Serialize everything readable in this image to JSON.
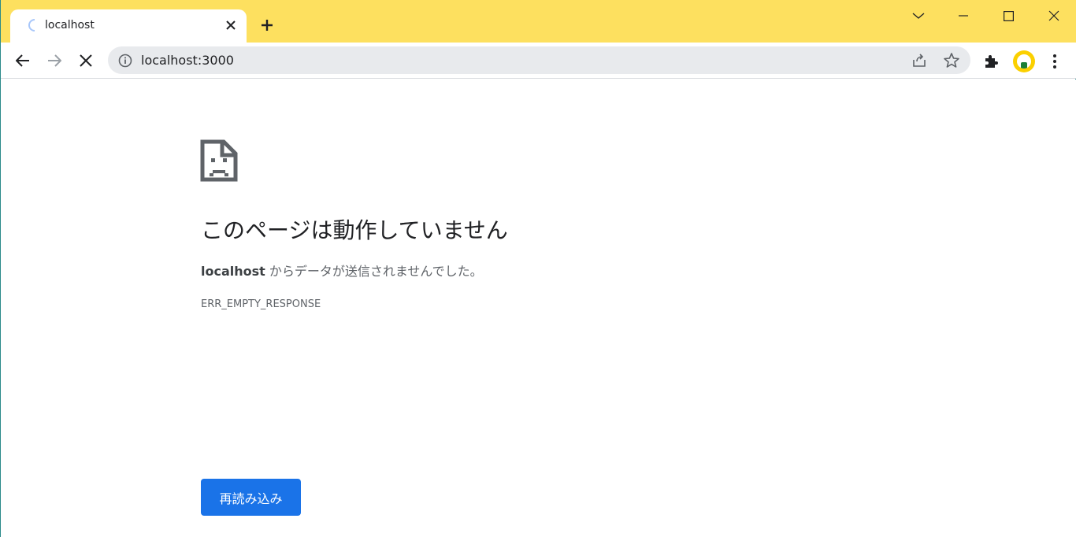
{
  "tab": {
    "title": "localhost",
    "close_icon": "close-icon",
    "spinner_icon": "loading-spinner-icon"
  },
  "newtab": {
    "icon": "plus-icon"
  },
  "window_controls": [
    "chevron-down-icon",
    "minimize-icon",
    "maximize-icon",
    "close-icon"
  ],
  "toolbar": {
    "back_icon": "arrow-left-icon",
    "forward_icon": "arrow-right-icon",
    "stop_icon": "close-icon",
    "url": "localhost:3000",
    "info_icon": "info-icon",
    "share_icon": "share-icon",
    "bookmark_icon": "star-icon",
    "extensions_icon": "puzzle-icon",
    "menu_icon": "kebab-menu-icon"
  },
  "error": {
    "icon": "sad-page-icon",
    "heading": "このページは動作していません",
    "host": "localhost",
    "summary_rest": " からデータが送信されませんでした。",
    "code": "ERR_EMPTY_RESPONSE",
    "reload_label": "再読み込み"
  },
  "colors": {
    "tabstrip": "#fde05f",
    "accent": "#1a73e8",
    "avatar": "#fbd000"
  }
}
